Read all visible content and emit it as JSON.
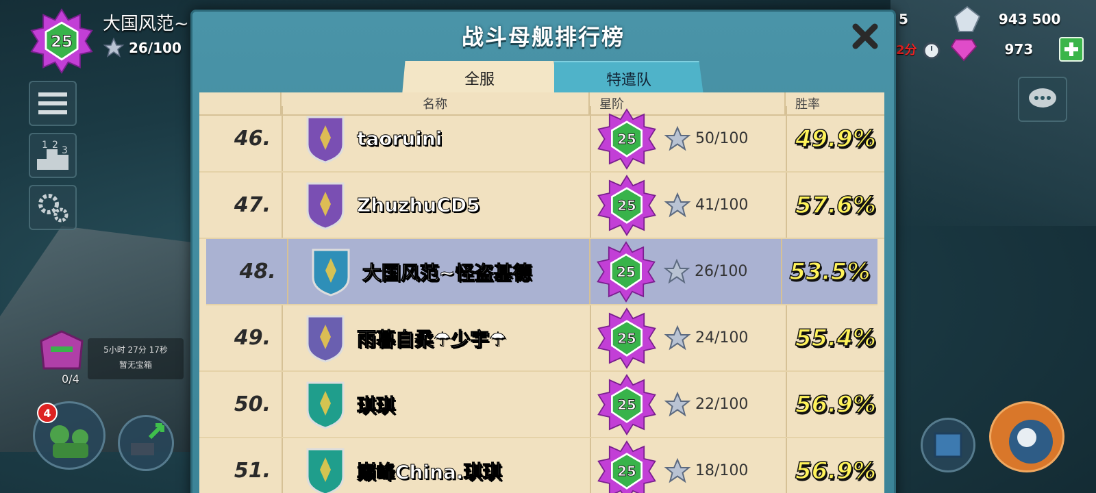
{
  "hud": {
    "player_level": "25",
    "player_name": "大国风范~",
    "player_xp": "26/100",
    "gold_partial": "5",
    "diamonds": "943 500",
    "timer_short": "2分",
    "gems": "973",
    "chest_timer": "5小时 27分 17秒",
    "chest_status": "暂无宝箱",
    "chest_count": "0/4",
    "notification_count": "4"
  },
  "panel": {
    "title": "战斗母舰排行榜",
    "tabs": [
      {
        "label": "全服",
        "active": true
      },
      {
        "label": "特遣队",
        "active": false
      }
    ],
    "columns": [
      "名称",
      "星阶",
      "胜率"
    ]
  },
  "rows": [
    {
      "rank": "46.",
      "name": "taoruini",
      "level": "25",
      "stars": "50/100",
      "win_rate": "49.9%",
      "emblem": "dragon-shield-icon",
      "emblem_color": "#7a4fb3",
      "me": false
    },
    {
      "rank": "47.",
      "name": "ZhuzhuCD5",
      "level": "25",
      "stars": "41/100",
      "win_rate": "57.6%",
      "emblem": "wolf-shield-icon",
      "emblem_color": "#7a4fb3",
      "me": false
    },
    {
      "rank": "48.",
      "name": "大国风范~怪盗基德",
      "level": "25",
      "stars": "26/100",
      "win_rate": "53.5%",
      "emblem": "sword-shield-icon",
      "emblem_color": "#2e8fb8",
      "me": true
    },
    {
      "rank": "49.",
      "name": "雨暮自柔☂少宇☂",
      "level": "25",
      "stars": "24/100",
      "win_rate": "55.4%",
      "emblem": "fist-shield-icon",
      "emblem_color": "#6a5fb0",
      "me": false
    },
    {
      "rank": "50.",
      "name": "琪琪",
      "level": "25",
      "stars": "22/100",
      "win_rate": "56.9%",
      "emblem": "crossed-rifles-shield-icon",
      "emblem_color": "#1f9e8c",
      "me": false
    },
    {
      "rank": "51.",
      "name": "巅峰China.琪琪",
      "level": "25",
      "stars": "18/100",
      "win_rate": "56.9%",
      "emblem": "chevron-shield-icon",
      "emblem_color": "#1f9e8c",
      "me": false
    }
  ],
  "colors": {
    "panel_blue": "#4a94a8",
    "parchment": "#f1e1c0",
    "highlight_row": "#aab2d2",
    "win_rate_yellow": "#fff35a",
    "level_badge_purple": "#c23fd6"
  }
}
